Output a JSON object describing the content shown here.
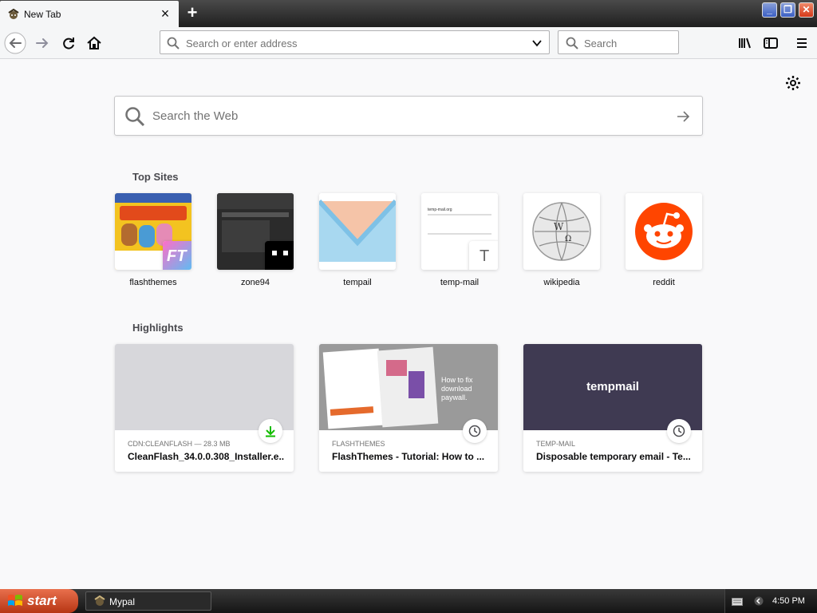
{
  "tab": {
    "title": "New Tab",
    "close": "×"
  },
  "newtab": "+",
  "window": {
    "minimize": "_",
    "maximize": "❐",
    "close": "✕"
  },
  "nav": {
    "url_placeholder": "Search or enter address",
    "search_placeholder": "Search"
  },
  "content": {
    "websearch_placeholder": "Search the Web",
    "topsites_title": "Top Sites",
    "highlights_title": "Highlights",
    "topsites": [
      {
        "label": "flashthemes",
        "badge": "FT"
      },
      {
        "label": "zone94"
      },
      {
        "label": "tempail"
      },
      {
        "label": "temp-mail",
        "badge": "T",
        "preview_text": "temp-mail.org"
      },
      {
        "label": "wikipedia"
      },
      {
        "label": "reddit"
      }
    ],
    "highlights": [
      {
        "context": "CDN:CLEANFLASH — 28.3 MB",
        "title": "CleanFlash_34.0.0.308_Installer.e...",
        "icon": "download-icon"
      },
      {
        "context": "FLASHTHEMES",
        "title": "FlashThemes - Tutorial: How to ...",
        "preview_text": "How to fix download paywall.",
        "icon": "clock-icon"
      },
      {
        "context": "TEMP-MAIL",
        "title": "Disposable temporary email - Te...",
        "preview_text": "tempmail",
        "icon": "clock-icon"
      }
    ]
  },
  "taskbar": {
    "start": "start",
    "task": "Mypal",
    "clock": "4:50 PM"
  },
  "colors": {
    "reddit": "#ff4500",
    "tempmail_bg": "#3f3a52",
    "download_green": "#12bc00"
  }
}
